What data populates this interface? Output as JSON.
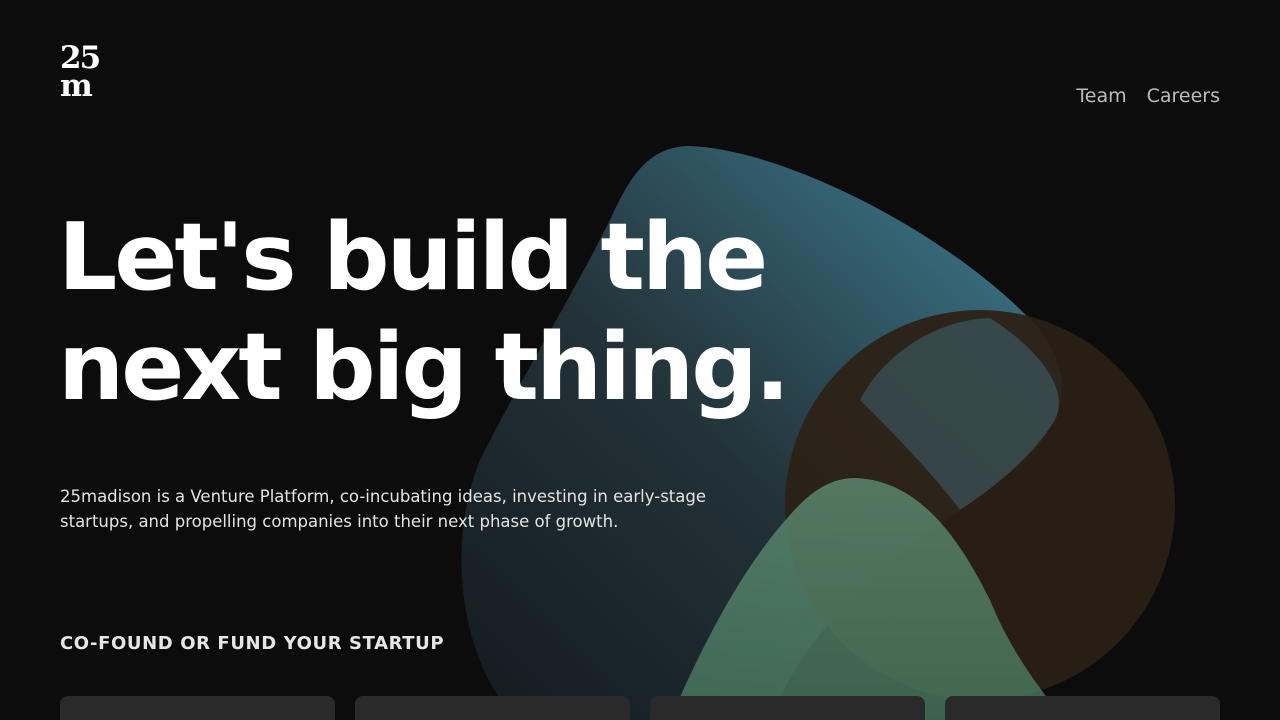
{
  "logo": {
    "line1": "25",
    "line2": "m"
  },
  "nav": {
    "items": [
      {
        "label": "Team"
      },
      {
        "label": "Careers"
      }
    ]
  },
  "hero": {
    "headline_line1": "Let's build the",
    "headline_line2": "next big thing.",
    "intro": "25madison is a Venture Platform, co-incubating ideas, investing in early-stage startups, and propelling companies into their next phase of growth."
  },
  "section": {
    "label": "CO-FOUND OR FUND YOUR STARTUP"
  },
  "colors": {
    "background": "#0c0c0c",
    "blob_blue": "#4a90a8",
    "blob_brown": "#2e2114",
    "blob_green": "#5a8c72",
    "card": "#2a2a2a"
  }
}
